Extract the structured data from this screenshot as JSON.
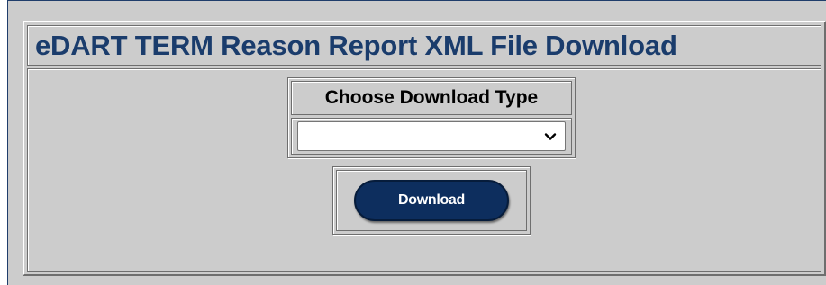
{
  "header": {
    "title": "eDART TERM Reason Report XML File Download"
  },
  "download_type": {
    "label": "Choose Download Type",
    "selected_value": ""
  },
  "actions": {
    "download_label": "Download"
  },
  "colors": {
    "title": "#1a3c6c",
    "panel_bg": "#cccccc",
    "button_bg": "#0d2e5e",
    "button_text": "#ffffff"
  },
  "icons": {
    "select_arrow": "chevron-down-icon"
  }
}
